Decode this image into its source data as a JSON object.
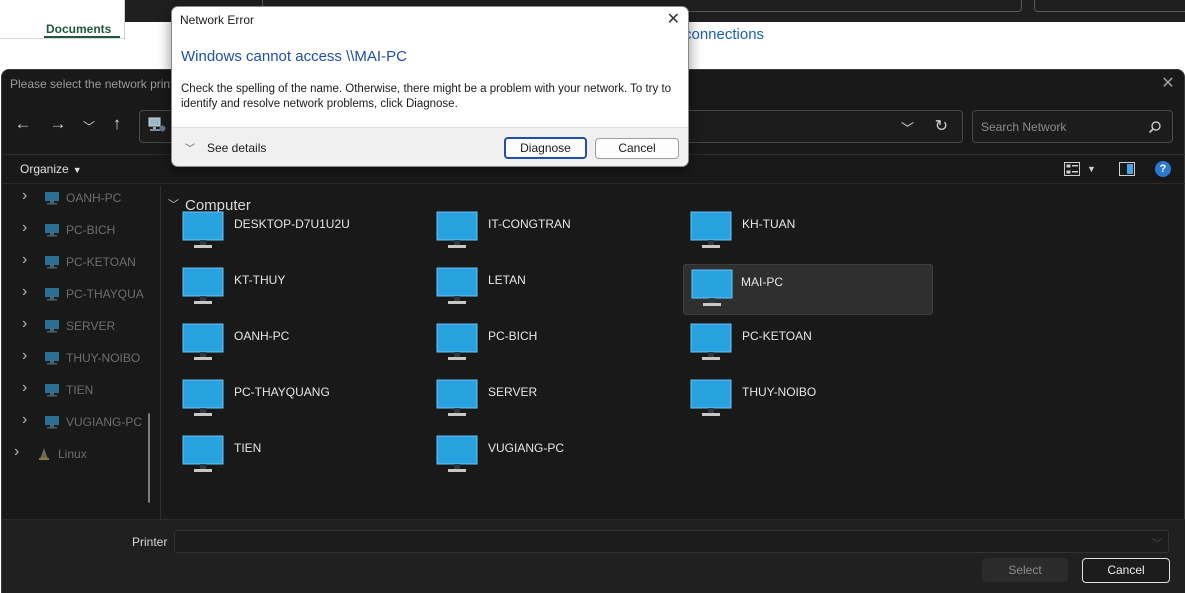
{
  "background_app": {
    "documents_tab": "Documents",
    "connections_link": "connections"
  },
  "file_dialog": {
    "title": "Please select the network print",
    "close_glyph": "✕",
    "search_placeholder": "Search Network",
    "organize_label": "Organize",
    "sidebar_items": [
      {
        "label": "OANH-PC",
        "type": "computer"
      },
      {
        "label": "PC-BICH",
        "type": "computer"
      },
      {
        "label": "PC-KETOAN",
        "type": "computer"
      },
      {
        "label": "PC-THAYQUA",
        "type": "computer"
      },
      {
        "label": "SERVER",
        "type": "computer"
      },
      {
        "label": "THUY-NOIBO",
        "type": "computer"
      },
      {
        "label": "TIEN",
        "type": "computer"
      },
      {
        "label": "VUGIANG-PC",
        "type": "computer"
      },
      {
        "label": "Linux",
        "type": "linux"
      }
    ],
    "group_heading": "Computer",
    "computers": [
      {
        "label": "DESKTOP-D7U1U2U",
        "selected": false
      },
      {
        "label": "IT-CONGTRAN",
        "selected": false
      },
      {
        "label": "KH-TUAN",
        "selected": false
      },
      {
        "label": "KT-THUY",
        "selected": false
      },
      {
        "label": "LETAN",
        "selected": false
      },
      {
        "label": "MAI-PC",
        "selected": true
      },
      {
        "label": "OANH-PC",
        "selected": false
      },
      {
        "label": "PC-BICH",
        "selected": false
      },
      {
        "label": "PC-KETOAN",
        "selected": false
      },
      {
        "label": "PC-THAYQUANG",
        "selected": false
      },
      {
        "label": "SERVER",
        "selected": false
      },
      {
        "label": "THUY-NOIBO",
        "selected": false
      },
      {
        "label": "TIEN",
        "selected": false
      },
      {
        "label": "VUGIANG-PC",
        "selected": false
      }
    ],
    "printer_label": "Printer",
    "printer_value": "",
    "select_button": "Select",
    "cancel_button": "Cancel"
  },
  "error_dialog": {
    "title": "Network Error",
    "close_glyph": "✕",
    "heading": "Windows cannot access \\\\MAI-PC",
    "message": "Check the spelling of the name. Otherwise, there might be a problem with your network. To try to identify and resolve network problems, click Diagnose.",
    "see_details": "See details",
    "diagnose_button": "Diagnose",
    "cancel_button": "Cancel"
  },
  "colors": {
    "accent_blue": "#1f4fa8",
    "monitor_screen": "#29a3e0",
    "dialog_bg": "#191919"
  }
}
